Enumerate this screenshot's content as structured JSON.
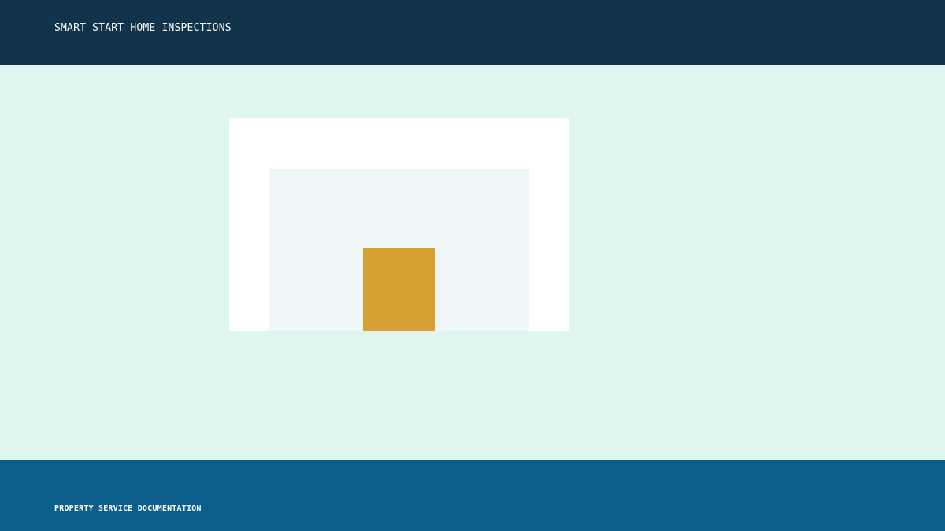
{
  "header": {
    "title": "SMART START HOME INSPECTIONS"
  },
  "footer": {
    "label": "PROPERTY SERVICE DOCUMENTATION"
  },
  "illustration": {
    "icon": "house-door-icon"
  },
  "colors": {
    "header_background": "#12344b",
    "page_background": "#dff6f0",
    "card_background": "#ffffff",
    "wall": "#eff6f8",
    "door": "#d89f32",
    "footer_background": "#0b5e8c",
    "text": "#ffffff"
  }
}
